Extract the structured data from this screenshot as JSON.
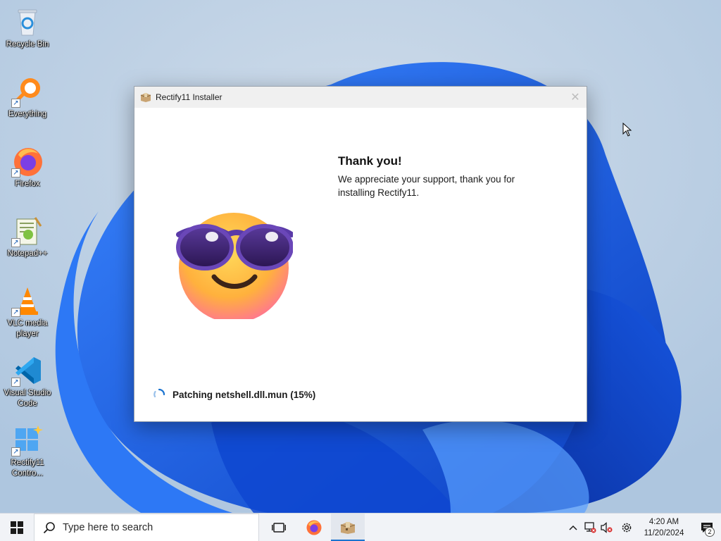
{
  "desktop": {
    "icons": [
      {
        "label": "Recycle Bin",
        "icon": "recycle-bin-icon"
      },
      {
        "label": "Everything",
        "icon": "everything-search-icon"
      },
      {
        "label": "Firefox",
        "icon": "firefox-icon"
      },
      {
        "label": "Notepad++",
        "icon": "notepad-plus-plus-icon"
      },
      {
        "label": "VLC media player",
        "icon": "vlc-icon"
      },
      {
        "label": "Visual Studio Code",
        "icon": "vscode-icon"
      },
      {
        "label": "Rectify11 Contro...",
        "icon": "rectify11-control-icon"
      }
    ]
  },
  "installer": {
    "title": "Rectify11 Installer",
    "close_glyph": "✕",
    "heading": "Thank you!",
    "message": "We appreciate your support, thank you for installing Rectify11.",
    "status": "Patching netshell.dll.mun (15%)",
    "progress_percent": 15
  },
  "taskbar": {
    "search_placeholder": "Type here to search",
    "apps": [
      {
        "name": "task-view-icon",
        "active": false
      },
      {
        "name": "firefox-icon",
        "active": false
      },
      {
        "name": "installer-icon",
        "active": true
      }
    ],
    "clock": {
      "time": "4:20 AM",
      "date": "11/20/2024"
    },
    "notification_count": "2"
  },
  "colors": {
    "accent": "#1a73d0",
    "wallpaper_bg": "#b8cde2",
    "bloom": "#1f5fe6"
  }
}
